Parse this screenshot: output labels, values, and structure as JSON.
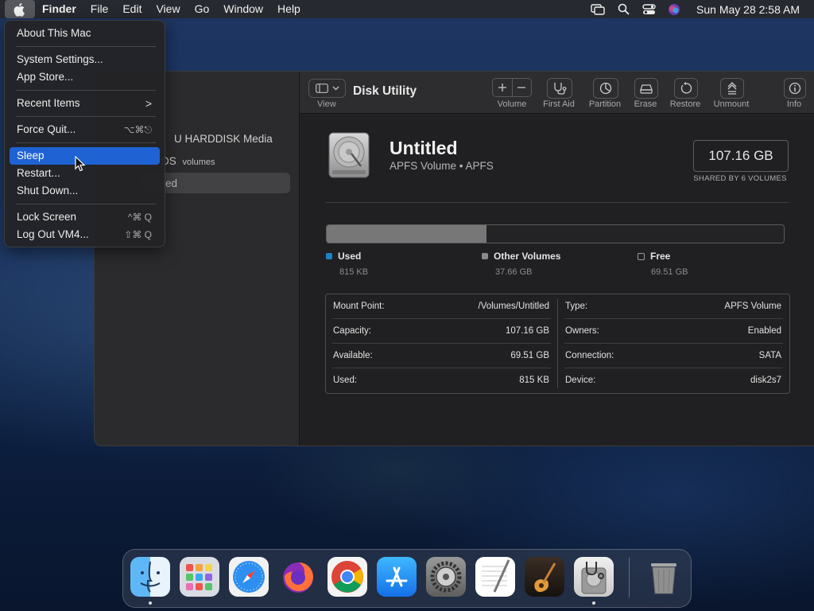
{
  "menubar": {
    "apple_icon": "apple-logo-icon",
    "app_name": "Finder",
    "items": [
      "File",
      "Edit",
      "View",
      "Go",
      "Window",
      "Help"
    ],
    "clock": "Sun May 28  2:58 AM",
    "status_icons": [
      "screen-mirroring-icon",
      "spotlight-search-icon",
      "control-center-icon",
      "siri-icon"
    ]
  },
  "apple_menu": {
    "items": [
      {
        "label": "About This Mac",
        "shortcut": ""
      },
      {
        "label": "System Settings...",
        "shortcut": ""
      },
      {
        "label": "App Store...",
        "shortcut": ""
      },
      {
        "label": "Recent Items",
        "shortcut": ">"
      },
      {
        "label": "Force Quit...",
        "shortcut": "⌥⌘⎋"
      },
      {
        "label": "Sleep",
        "shortcut": "",
        "highlighted": true
      },
      {
        "label": "Restart...",
        "shortcut": ""
      },
      {
        "label": "Shut Down...",
        "shortcut": ""
      },
      {
        "label": "Lock Screen",
        "shortcut": "^⌘ Q"
      },
      {
        "label": "Log Out VM4...",
        "shortcut": "⇧⌘ Q"
      }
    ]
  },
  "disk_utility": {
    "title": "Disk Utility",
    "view_label": "View",
    "sidebar": {
      "disk_label": "U HARDDISK Media",
      "container_label": "DS",
      "container_sub": "volumes",
      "volume_label": "led"
    },
    "toolbar": [
      {
        "label": "Volume",
        "icon": "add-remove-volume-icon"
      },
      {
        "label": "First Aid",
        "icon": "stethoscope-icon"
      },
      {
        "label": "Partition",
        "icon": "partition-pie-icon"
      },
      {
        "label": "Erase",
        "icon": "erase-drive-icon"
      },
      {
        "label": "Restore",
        "icon": "restore-arrow-icon"
      },
      {
        "label": "Unmount",
        "icon": "unmount-icon"
      },
      {
        "label": "Info",
        "icon": "info-icon"
      }
    ],
    "volume": {
      "name": "Untitled",
      "subtitle": "APFS Volume • APFS",
      "size": "107.16 GB",
      "shared_note": "SHARED BY 6 VOLUMES"
    },
    "usage": {
      "used_fraction": 0.35,
      "legend": [
        {
          "label": "Used",
          "value": "815 KB",
          "color": "#1a82c8"
        },
        {
          "label": "Other Volumes",
          "value": "37.66 GB",
          "color": "#8a8a8a"
        },
        {
          "label": "Free",
          "value": "69.51 GB",
          "color": "#202022"
        }
      ]
    },
    "info_left": [
      {
        "key": "Mount Point:",
        "value": "/Volumes/Untitled"
      },
      {
        "key": "Capacity:",
        "value": "107.16 GB"
      },
      {
        "key": "Available:",
        "value": "69.51 GB"
      },
      {
        "key": "Used:",
        "value": "815 KB"
      }
    ],
    "info_right": [
      {
        "key": "Type:",
        "value": "APFS Volume"
      },
      {
        "key": "Owners:",
        "value": "Enabled"
      },
      {
        "key": "Connection:",
        "value": "SATA"
      },
      {
        "key": "Device:",
        "value": "disk2s7"
      }
    ]
  },
  "dock": {
    "apps": [
      {
        "name": "finder-icon",
        "running": true
      },
      {
        "name": "launchpad-icon",
        "running": false
      },
      {
        "name": "safari-icon",
        "running": false
      },
      {
        "name": "firefox-icon",
        "running": false
      },
      {
        "name": "chrome-icon",
        "running": false
      },
      {
        "name": "app-store-icon",
        "running": false
      },
      {
        "name": "system-settings-icon",
        "running": false
      },
      {
        "name": "textedit-icon",
        "running": false
      },
      {
        "name": "garageband-icon",
        "running": false
      },
      {
        "name": "disk-utility-icon",
        "running": true
      },
      {
        "name": "trash-icon",
        "running": false
      }
    ]
  }
}
